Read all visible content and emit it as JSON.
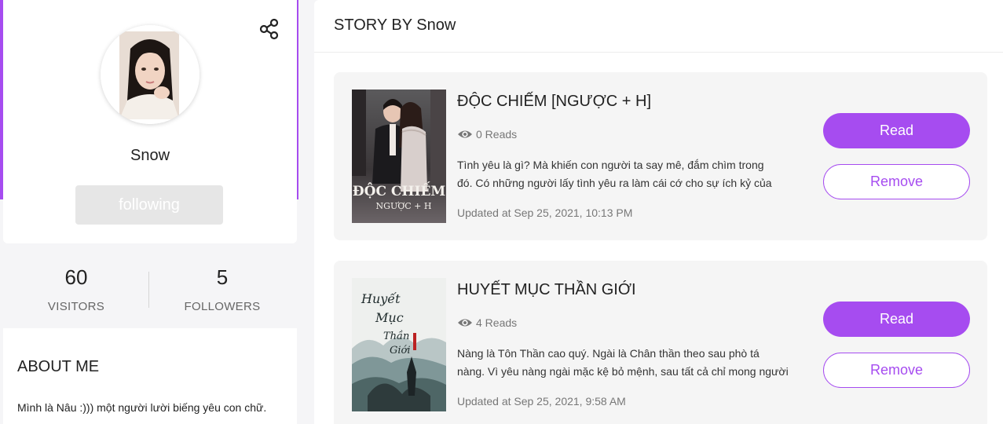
{
  "colors": {
    "accent": "#a64cf0",
    "card_bg": "#f5f5f5",
    "following_bg": "#e6e6e6"
  },
  "profile": {
    "share_icon": "share-icon",
    "avatar_alt": "avatar",
    "username": "Snow",
    "follow_button_label": "following",
    "stats": {
      "visitors_value": "60",
      "visitors_label": "VISITORS",
      "followers_value": "5",
      "followers_label": "FOLLOWERS"
    },
    "about": {
      "title": "ABOUT ME",
      "text": "Mình là Nâu :))) một người lười biếng yêu con chữ."
    }
  },
  "stories_section": {
    "title": "STORY BY Snow",
    "read_label": "Read",
    "remove_label": "Remove",
    "stories": [
      {
        "title": "ĐỘC CHIẾM [NGƯỢC + H]",
        "reads": "0 Reads",
        "desc_line1": "Tình yêu là gì? Mà khiến con người ta say mê, đắm chìm trong",
        "desc_line2": "đó. Có những người lấy tình yêu ra làm cái cớ cho sự ích kỷ của",
        "updated": "Updated at Sep 25, 2021, 10:13 PM",
        "cover_icon": "book-cover-image"
      },
      {
        "title": "HUYẾT MỤC THẦN GIỚI",
        "reads": "4 Reads",
        "desc_line1": "Nàng là Tôn Thần cao quý. Ngài là Chân thần theo sau phò tá",
        "desc_line2": "nàng. Vì yêu nàng ngài mặc kệ bỏ mệnh, sau tất cả chỉ mong người",
        "updated": "Updated at Sep 25, 2021, 9:58 AM",
        "cover_icon": "book-cover-image"
      }
    ]
  }
}
